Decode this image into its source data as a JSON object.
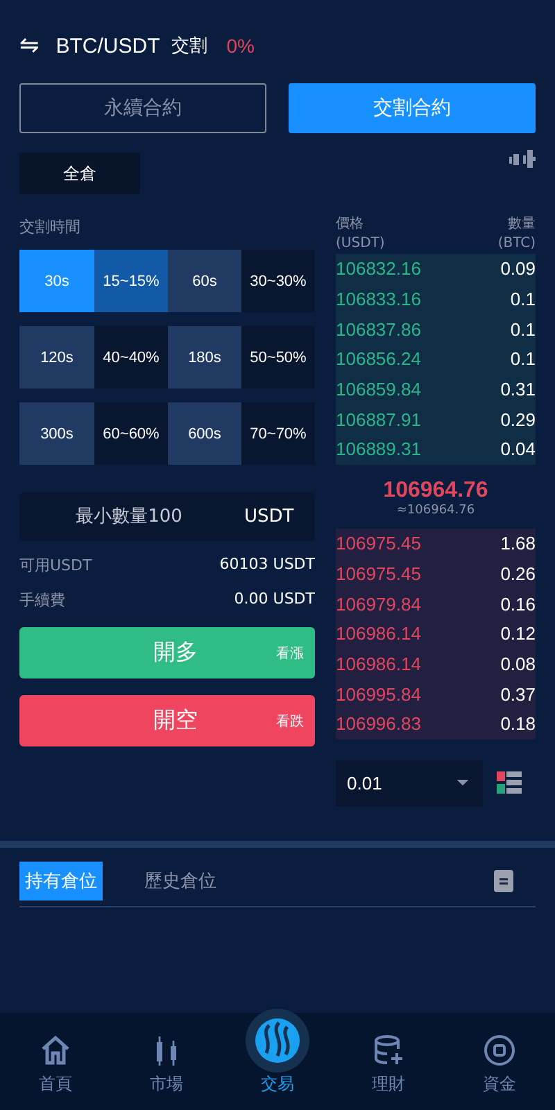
{
  "header": {
    "swap_icon": "⇋",
    "pair": "BTC/USDT",
    "type": "交割",
    "change": "0%"
  },
  "contract_tabs": [
    {
      "label": "永續合約",
      "selected": false
    },
    {
      "label": "交割合約",
      "selected": true
    }
  ],
  "margin_mode": "全倉",
  "delivery_time": {
    "label": "交割時間",
    "options": [
      {
        "time": "30s",
        "range": "15~15%",
        "selected": true
      },
      {
        "time": "60s",
        "range": "30~30%",
        "selected": false
      },
      {
        "time": "120s",
        "range": "40~40%",
        "selected": false
      },
      {
        "time": "180s",
        "range": "50~50%",
        "selected": false
      },
      {
        "time": "300s",
        "range": "60~60%",
        "selected": false
      },
      {
        "time": "600s",
        "range": "70~70%",
        "selected": false
      }
    ]
  },
  "amount": {
    "placeholder": "最小數量100",
    "unit": "USDT"
  },
  "info": [
    {
      "label": "可用USDT",
      "value": "60103 USDT"
    },
    {
      "label": "手續費",
      "value": "0.00 USDT"
    }
  ],
  "actions": [
    {
      "kind": "long",
      "label": "開多",
      "hint": "看漲"
    },
    {
      "kind": "short",
      "label": "開空",
      "hint": "看跌"
    }
  ],
  "order_book": {
    "price_header": "價格",
    "price_unit": "(USDT)",
    "amount_header": "數量",
    "amount_unit": "(BTC)",
    "bids": [
      {
        "price": "106832.16",
        "amount": "0.09"
      },
      {
        "price": "106833.16",
        "amount": "0.1"
      },
      {
        "price": "106837.86",
        "amount": "0.1"
      },
      {
        "price": "106856.24",
        "amount": "0.1"
      },
      {
        "price": "106859.84",
        "amount": "0.31"
      },
      {
        "price": "106887.91",
        "amount": "0.29"
      },
      {
        "price": "106889.31",
        "amount": "0.04"
      }
    ],
    "last_price": "106964.76",
    "approx": "≈106964.76",
    "asks": [
      {
        "price": "106975.45",
        "amount": "1.68"
      },
      {
        "price": "106975.45",
        "amount": "0.26"
      },
      {
        "price": "106979.84",
        "amount": "0.16"
      },
      {
        "price": "106986.14",
        "amount": "0.12"
      },
      {
        "price": "106986.14",
        "amount": "0.08"
      },
      {
        "price": "106995.84",
        "amount": "0.37"
      },
      {
        "price": "106996.83",
        "amount": "0.18"
      }
    ],
    "precision": "0.01"
  },
  "position_tabs": [
    {
      "label": "持有倉位",
      "selected": true
    },
    {
      "label": "歷史倉位",
      "selected": false
    }
  ],
  "nav": [
    {
      "kind": "home",
      "label": "首頁",
      "selected": false
    },
    {
      "kind": "market",
      "label": "市場",
      "selected": false
    },
    {
      "kind": "trade",
      "label": "交易",
      "selected": true
    },
    {
      "kind": "finance",
      "label": "理財",
      "selected": false
    },
    {
      "kind": "assets",
      "label": "資金",
      "selected": false
    }
  ]
}
